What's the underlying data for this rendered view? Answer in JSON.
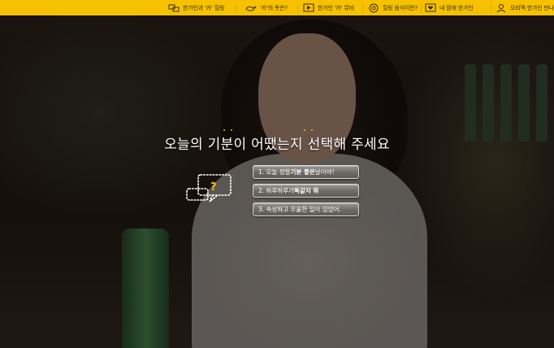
{
  "nav": {
    "items": [
      {
        "label": "한가인과 '카' 힐링",
        "icon": "chat-bubbles-icon"
      },
      {
        "label": "'카'의 뜻은?",
        "icon": "bird-icon"
      },
      {
        "label": "한가인 '카' 뮤비",
        "icon": "video-play-icon"
      },
      {
        "label": "힐링 음식이란?",
        "icon": "food-plate-icon"
      },
      {
        "label": "내 맘에 한가인",
        "icon": "heart-message-icon"
      },
      {
        "label": "오비맥 한가인 만나",
        "icon": "person-icon"
      }
    ]
  },
  "prompt": {
    "title": "오늘의 기분이 어땠는지 선택해 주세요"
  },
  "choices": [
    {
      "prefix": "1. 오늘 정말 ",
      "bold": "기분 좋은",
      "suffix": " 날이야!"
    },
    {
      "prefix": "2. 하루하루가 ",
      "bold": "똑같지 뭐",
      "suffix": ""
    },
    {
      "prefix": "3. 속상하고 우울한 일이 있었어.",
      "bold": "",
      "suffix": ""
    }
  ],
  "colors": {
    "accent": "#f6c200",
    "highlight": "#f5c400"
  }
}
